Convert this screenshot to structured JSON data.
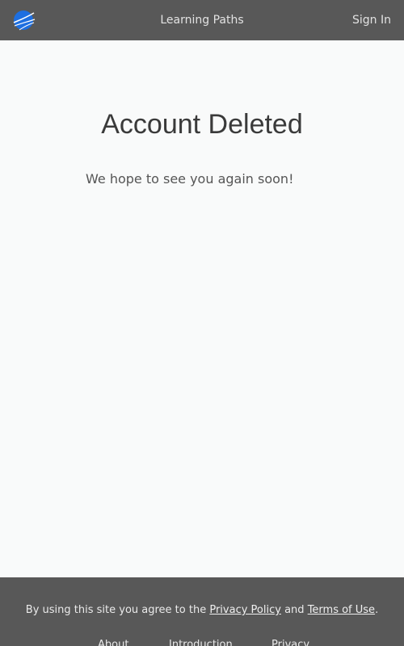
{
  "nav": {
    "logo_name": "site-logo",
    "center_link": "Learning Paths",
    "signin_link": "Sign In"
  },
  "main": {
    "title": "Account Deleted",
    "message": "We hope to see you again soon!"
  },
  "footer": {
    "agree_prefix": "By using this site you agree to the ",
    "privacy_policy": "Privacy Policy",
    "agree_and": " and ",
    "terms_of_use": "Terms of Use",
    "agree_suffix": ".",
    "links": [
      "About",
      "Introduction",
      "Privacy"
    ]
  },
  "colors": {
    "header_bg": "#585858",
    "page_bg": "#f9fafa",
    "logo_blue": "#1a73e8"
  }
}
